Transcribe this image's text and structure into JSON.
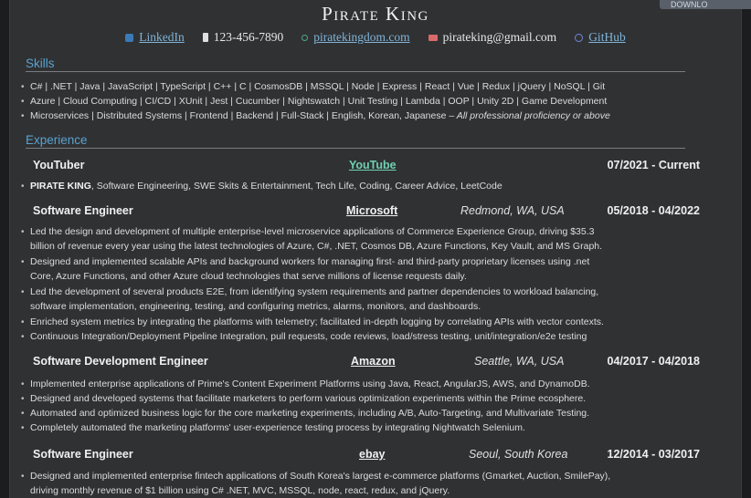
{
  "header": {
    "name": "Pirate King",
    "linkedin": "LinkedIn",
    "phone": "123-456-7890",
    "website": "piratekingdom.com",
    "email": "pirateking@gmail.com",
    "github": "GitHub"
  },
  "top_chip": "DOWNLO",
  "skills": {
    "heading": "Skills",
    "lines": [
      "C# | .NET | Java | JavaScript | TypeScript | C++ | C | CosmosDB | MSSQL | Node | Express | React | Vue | Redux | jQuery | NoSQL | Git",
      "Azure | Cloud Computing | CI/CD | XUnit | Jest | Cucumber | Nightswatch | Unit Testing | Lambda | OOP | Unity 2D | Game Development",
      "Microservices | Distributed Systems | Frontend | Backend | Full-Stack | English, Korean, Japanese –"
    ],
    "line3_italic": " All professional proficiency or above"
  },
  "experience": {
    "heading": "Experience",
    "jobs": [
      {
        "title": "YouTuber",
        "company": "YouTube",
        "location": "",
        "dates": "07/2021 - Current",
        "bullets": [
          {
            "bold": "PIRATE KING",
            "text": ", Software Engineering, SWE Skits & Entertainment, Tech Life, Coding, Career Advice, LeetCode"
          }
        ]
      },
      {
        "title": "Software Engineer",
        "company": "Microsoft",
        "location": "Redmond, WA, USA",
        "dates": "05/2018 - 04/2022",
        "bullets": [
          "Led the design and development of multiple enterprise-level microservice applications of Commerce Experience Group, driving $35.3",
          "billion of revenue every year using the latest technologies of Azure, C#, .NET, Cosmos DB, Azure Functions, Key Vault, and MS Graph.",
          "Designed and implemented scalable APIs and background workers for managing first- and third-party proprietary licenses using .net",
          "Core, Azure Functions, and other Azure cloud technologies that serve millions of license requests daily.",
          "Led the development of several products E2E, from identifying system requirements and partner dependencies to workload balancing,",
          "software implementation, engineering, testing, and configuring metrics, alarms, monitors, and dashboards.",
          "Enriched system metrics by integrating the platforms with telemetry; facilitated in-depth logging by correlating APIs with vector contexts.",
          "Continuous Integration/Deployment Pipeline Integration, pull requests, code reviews, load/stress testing, unit/integration/e2e testing"
        ]
      },
      {
        "title": "Software Development Engineer",
        "company": "Amazon",
        "location": "Seattle, WA, USA",
        "dates": "04/2017 - 04/2018",
        "bullets": [
          "Implemented enterprise applications of Prime's Content Experiment Platforms using Java, React, AngularJS, AWS, and DynamoDB.",
          "Designed and developed systems that facilitate marketers to perform various optimization experiments within the Prime ecosphere.",
          "Automated and optimized business logic for the core marketing experiments, including A/B, Auto-Targeting, and Multivariate Testing.",
          "Completely automated the marketing platforms' user-experience testing process by integrating Nightwatch Selenium."
        ]
      },
      {
        "title": "Software Engineer",
        "company": "ebay",
        "location": "Seoul, South Korea",
        "dates": "12/2014 - 03/2017",
        "bullets": [
          "Designed and implemented enterprise fintech applications of South Korea's largest e-commerce platforms (Gmarket, Auction, SmilePay),",
          "driving monthly revenue of $1 billion using C# .NET, MVC, MSSQL, node, react, redux, and jQuery."
        ]
      }
    ]
  }
}
